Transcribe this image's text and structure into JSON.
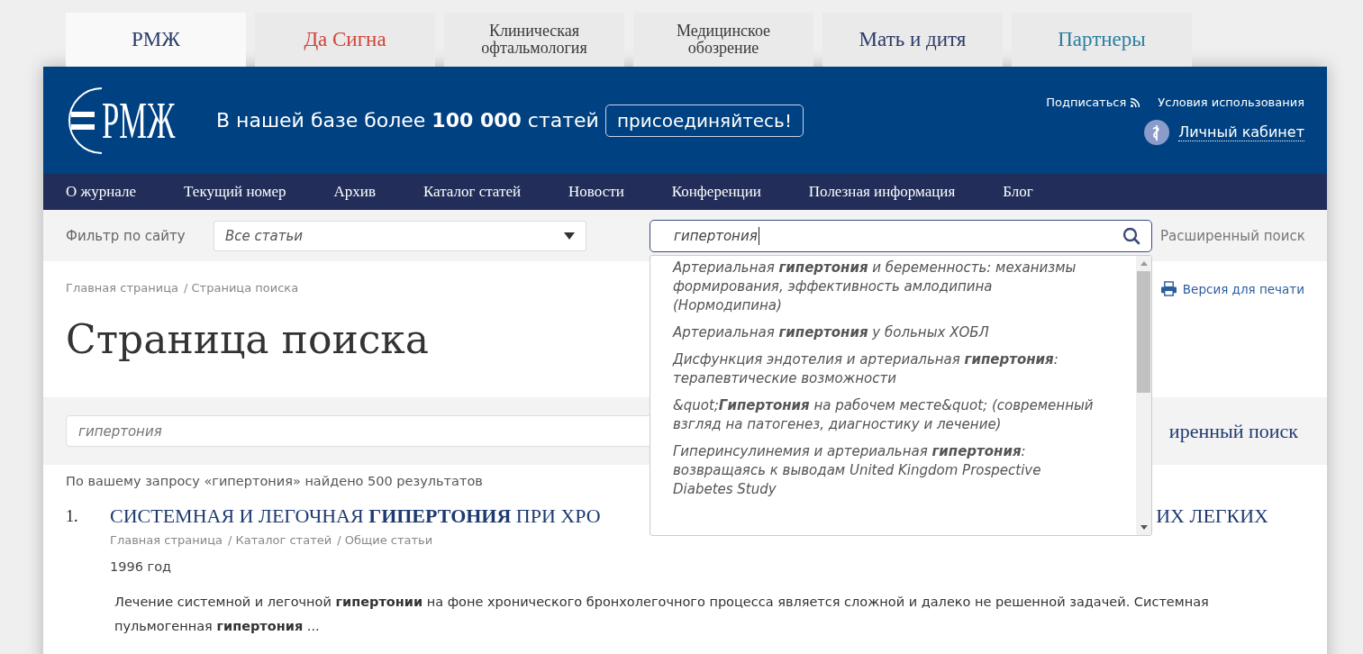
{
  "site_tabs": [
    {
      "label": "РМЖ",
      "selected": true,
      "color": "#2b3a67"
    },
    {
      "label": "Да Сигна",
      "selected": false,
      "color": "#d0433a"
    },
    {
      "label": "Клиническая офтальмология",
      "selected": false,
      "color": "#3a3a3a"
    },
    {
      "label": "Медицинское обозрение",
      "selected": false,
      "color": "#3a3a3a"
    },
    {
      "label": "Мать и дитя",
      "selected": false,
      "color": "#2b3a67"
    },
    {
      "label": "Партнеры",
      "selected": false,
      "color": "#2a7fa0"
    }
  ],
  "header": {
    "logo_text": "РМЖ",
    "tagline": "В нашей базе более **100 000** статей",
    "join_button": "присоединяйтесь!",
    "subscribe": "Подписаться",
    "terms": "Условия использования",
    "account": "Личный кабинет"
  },
  "nav": [
    "О журнале",
    "Текущий номер",
    "Архив",
    "Каталог статей",
    "Новости",
    "Конференции",
    "Полезная информация",
    "Блог"
  ],
  "filter": {
    "label": "Фильтр по сайту",
    "select_value": "Все статьи",
    "search_value": "гипертония",
    "advanced": "Расширенный поиск"
  },
  "suggestions": [
    "Артериальная **гипертония** и беременность: механизмы формирования, эффективность амлодипина (Нормодипина)",
    "Артериальная **гипертония** у больных ХОБЛ",
    "Дисфункция эндотелия и артериальная **гипертония**: терапевтические возможности",
    "&quot;**Гипертония** на рабочем месте&quot; (современный взгляд на патогенез, диагностику и лечение)",
    "Гиперинсулинемия и артериальная **гипертония**: возвращаясь к выводам United Kingdom Prospective Diabetes Study"
  ],
  "breadcrumb": [
    "Главная страница",
    "/ Страница поиска"
  ],
  "print_link": "Версия для печати",
  "page_title": "Страница поиска",
  "search_row": {
    "value": "гипертония",
    "advanced_visible": "иренный поиск"
  },
  "summary": "По вашему запросу «гипертония» найдено 500 результатов",
  "results": [
    {
      "number": "1.",
      "title_start": "СИСТЕМНАЯ И ЛЕГОЧНАЯ **ГИПЕРТОНИЯ** ПРИ ХРО",
      "title_end": "ИХ ЛЕГКИХ",
      "breadcrumb": [
        "Главная страница",
        "/ Каталог статей",
        "/ Общие статьи"
      ],
      "year": "1996 год",
      "snippet": "Лечение системной и легочной **гипертонии** на фоне хронического бронхолегочного процесса является сложной и далеко не решенной задачей. Системная пульмогенная **гипертония** ..."
    }
  ]
}
